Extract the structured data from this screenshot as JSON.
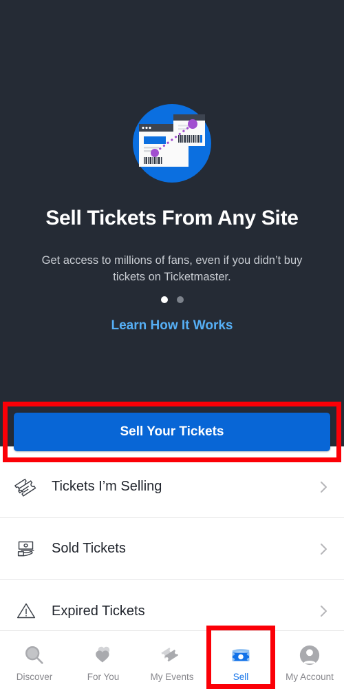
{
  "hero": {
    "illustration_name": "sell-tickets-illustration",
    "title": "Sell Tickets From Any Site",
    "subtitle": "Get access to millions of fans, even if you didn’t buy tickets on Ticketmaster.",
    "link_label": "Learn How It Works",
    "carousel": {
      "total": 2,
      "active_index": 0
    }
  },
  "cta": {
    "label": "Sell Your Tickets"
  },
  "menu": {
    "rows": [
      {
        "label": "Tickets I’m Selling",
        "icon": "tickets-icon"
      },
      {
        "label": "Sold Tickets",
        "icon": "money-hand-icon"
      },
      {
        "label": "Expired Tickets",
        "icon": "warning-triangle-icon"
      }
    ]
  },
  "bottom_nav": {
    "items": [
      {
        "label": "Discover",
        "icon": "search-icon",
        "active": false
      },
      {
        "label": "For You",
        "icon": "hearts-icon",
        "active": false
      },
      {
        "label": "My Events",
        "icon": "tickets-icon",
        "active": false
      },
      {
        "label": "Sell",
        "icon": "money-icon",
        "active": true
      },
      {
        "label": "My Account",
        "icon": "person-icon",
        "active": false
      }
    ]
  },
  "colors": {
    "hero_background": "#252b35",
    "primary_blue": "#0866d6",
    "link_blue": "#56aff5",
    "active_nav_blue": "#1272e8",
    "annotation_red": "#fb0007",
    "inactive_gray": "#86868b",
    "subtitle_gray": "#c9cdd3"
  }
}
